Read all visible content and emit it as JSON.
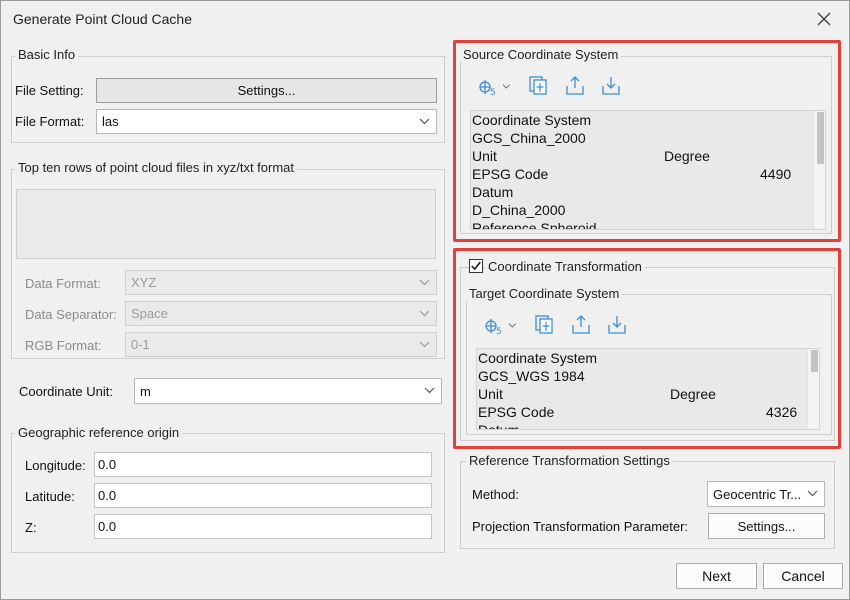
{
  "dialog": {
    "title": "Generate Point Cloud Cache"
  },
  "basic_info": {
    "label": "Basic Info",
    "file_setting_label": "File Setting:",
    "settings_button": "Settings...",
    "file_format_label": "File Format:",
    "file_format_value": "las"
  },
  "preview": {
    "label": "Top ten rows of point cloud files in xyz/txt format",
    "data_format_label": "Data Format:",
    "data_format_value": "XYZ",
    "data_separator_label": "Data Separator:",
    "data_separator_value": "Space",
    "rgb_format_label": "RGB Format:",
    "rgb_format_value": "0-1"
  },
  "coordinate_unit": {
    "label": "Coordinate Unit:",
    "value": "m"
  },
  "geo_origin": {
    "label": "Geographic reference origin",
    "longitude_label": "Longitude:",
    "longitude_value": "0.0",
    "latitude_label": "Latitude:",
    "latitude_value": "0.0",
    "z_label": "Z:",
    "z_value": "0.0"
  },
  "source_cs": {
    "label": "Source Coordinate System",
    "rows": [
      {
        "key": "Coordinate System",
        "value": ""
      },
      {
        "key": "GCS_China_2000",
        "value": ""
      },
      {
        "key": "Unit",
        "value": "Degree"
      },
      {
        "key": "EPSG Code",
        "value": "4490"
      },
      {
        "key": "Datum",
        "value": ""
      },
      {
        "key": "D_China_2000",
        "value": ""
      },
      {
        "key": "Reference Spheroid",
        "value": ""
      }
    ]
  },
  "transformation": {
    "checkbox_label": "Coordinate Transformation",
    "checked": true,
    "target_label": "Target Coordinate System",
    "rows": [
      {
        "key": "Coordinate System",
        "value": ""
      },
      {
        "key": "GCS_WGS 1984",
        "value": ""
      },
      {
        "key": "Unit",
        "value": "Degree"
      },
      {
        "key": "EPSG Code",
        "value": "4326"
      },
      {
        "key": "Datum",
        "value": ""
      }
    ]
  },
  "ref_transform": {
    "label": "Reference Transformation Settings",
    "method_label": "Method:",
    "method_value": "Geocentric Tr...",
    "param_label": "Projection Transformation Parameter:",
    "param_button": "Settings..."
  },
  "footer": {
    "next_button": "Next",
    "cancel_button": "Cancel"
  },
  "colors": {
    "highlight": "#e0413b",
    "icon_blue": "#3a8fd6"
  }
}
